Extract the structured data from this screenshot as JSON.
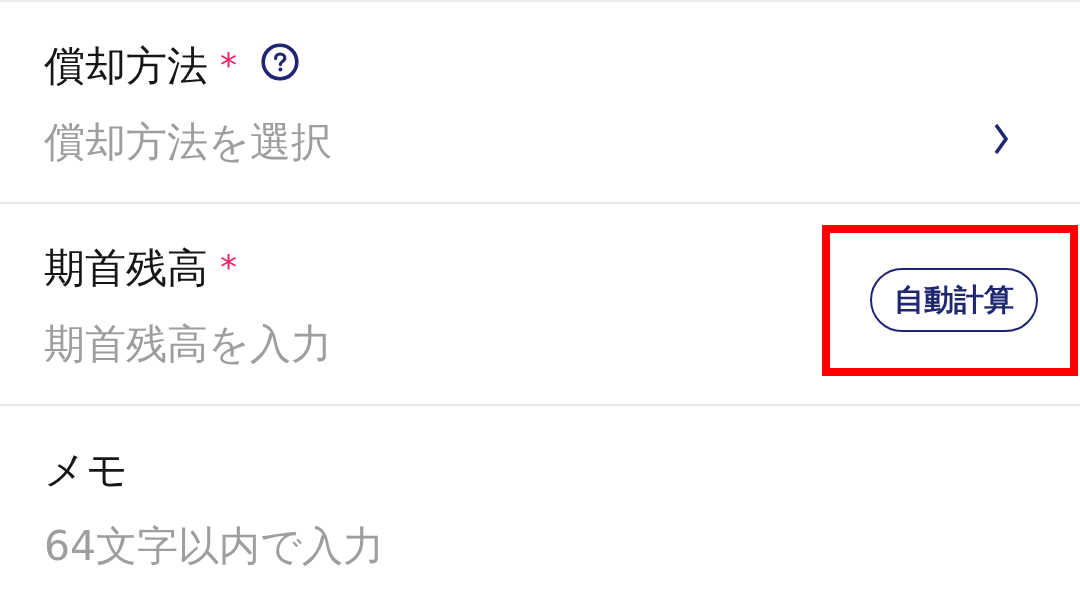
{
  "form": {
    "fields": [
      {
        "kind": "select",
        "label": "償却方法",
        "required_mark": "*",
        "help": true,
        "placeholder": "償却方法を選択"
      },
      {
        "kind": "text_input",
        "label": "期首残高",
        "required_mark": "*",
        "placeholder": "期首残高を入力",
        "action": {
          "label": "自動計算",
          "highlighted": true
        }
      },
      {
        "kind": "text_input",
        "label": "メモ",
        "placeholder": "64文字以内で入力"
      }
    ]
  }
}
